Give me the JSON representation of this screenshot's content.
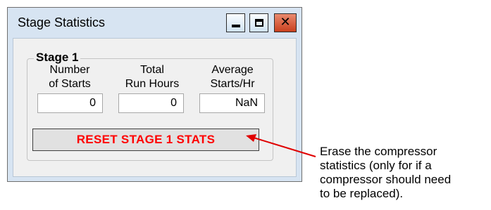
{
  "window": {
    "title": "Stage Statistics",
    "controls": {
      "minimize_icon": "minimize-icon",
      "maximize_icon": "maximize-icon",
      "close_icon": "close-icon",
      "close_glyph": "✕"
    },
    "colors": {
      "frame": "#d7e4f2",
      "close_button": "#c9401e"
    }
  },
  "stage": {
    "group_title": "Stage 1",
    "columns": [
      {
        "label_line1": "Number",
        "label_line2": "of Starts",
        "value": "0"
      },
      {
        "label_line1": "Total",
        "label_line2": "Run Hours",
        "value": "0"
      },
      {
        "label_line1": "Average",
        "label_line2": "Starts/Hr",
        "value": "NaN"
      }
    ],
    "reset_button_label": "RESET STAGE 1 STATS",
    "reset_button_color": "#ff0000"
  },
  "annotation": {
    "lines": [
      "Erase the compressor",
      "statistics (only for if a",
      "compressor should need",
      "to be replaced)."
    ],
    "arrow_color": "#e00000"
  }
}
